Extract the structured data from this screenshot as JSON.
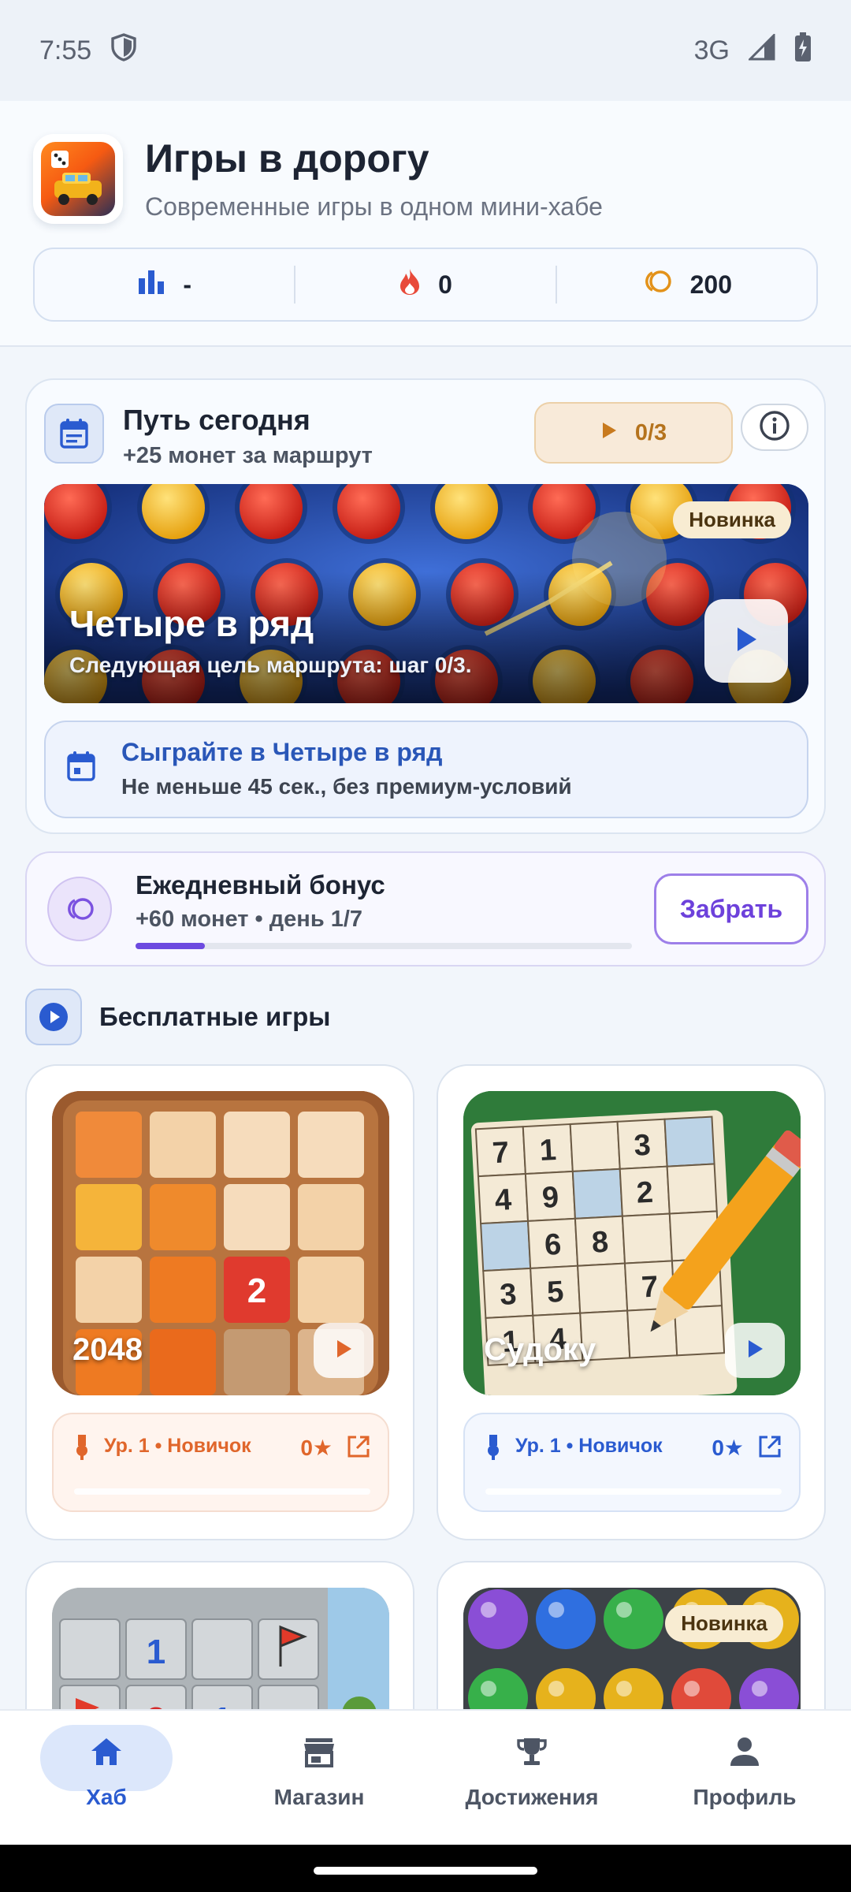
{
  "status_bar": {
    "time": "7:55",
    "network": "3G"
  },
  "header": {
    "title": "Игры в дорогу",
    "subtitle": "Современные игры в одном мини-хабе",
    "stats": {
      "rank": "-",
      "streak": "0",
      "coins": "200"
    }
  },
  "route": {
    "title": "Путь сегодня",
    "reward": "+25 монет за маршрут",
    "progress": "0/3",
    "banner": {
      "badge": "Новинка",
      "title": "Четыре в ряд",
      "subtitle": "Следующая цель маршрута: шаг 0/3."
    },
    "task": {
      "title": "Сыграйте в Четыре в ряд",
      "subtitle": "Не меньше 45 сек., без премиум-условий"
    }
  },
  "bonus": {
    "title": "Ежедневный бонус",
    "subtitle": "+60 монет • день 1/7",
    "progress_fraction": 0.14,
    "claim_label": "Забрать"
  },
  "free_games": {
    "title": "Бесплатные игры",
    "games": [
      {
        "name": "2048",
        "level": "Ур. 1 • Новичок",
        "stars": "0★"
      },
      {
        "name": "Судоку",
        "level": "Ур. 1 • Новичок",
        "stars": "0★"
      }
    ],
    "partial_badge": "Новинка",
    "sudoku_digits": [
      "7",
      "1",
      "",
      "3",
      "",
      "4",
      "9",
      "",
      "2",
      "",
      "",
      "6",
      "8",
      "",
      "",
      "3",
      "5",
      "",
      "7",
      "",
      "1",
      "4",
      "",
      "",
      "",
      ""
    ]
  },
  "bottom_nav": {
    "items": [
      {
        "label": "Хаб",
        "icon": "home-icon",
        "active": true
      },
      {
        "label": "Магазин",
        "icon": "store-icon",
        "active": false
      },
      {
        "label": "Достижения",
        "icon": "trophy-icon",
        "active": false
      },
      {
        "label": "Профиль",
        "icon": "person-icon",
        "active": false
      }
    ]
  },
  "colors": {
    "accent_blue": "#2a5bd0",
    "accent_purple": "#6d41db",
    "accent_orange": "#e0662b",
    "flame_red": "#e84a3a",
    "coin_orange": "#e3921a"
  }
}
